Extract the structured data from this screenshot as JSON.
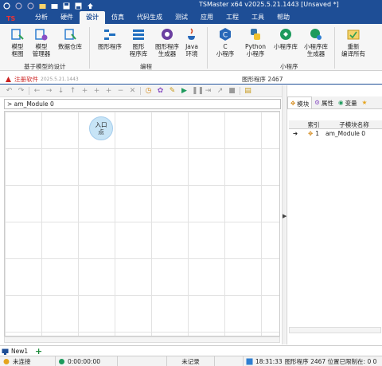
{
  "app": {
    "title": "TSMaster x64 v2025.5.21.1443 [Unsaved *]",
    "logo_text": "TS"
  },
  "quick_access": [
    "undo-icon",
    "back-icon",
    "forward-icon",
    "open-folder-icon",
    "new-folder-icon",
    "save-icon",
    "save-as-icon",
    "upload-icon"
  ],
  "menu": {
    "tabs": [
      "分析",
      "硬件",
      "设计",
      "仿真",
      "代码生成",
      "测试",
      "应用",
      "工程",
      "工具",
      "帮助"
    ],
    "active": "设计"
  },
  "ribbon": {
    "buttons": [
      {
        "label1": "模型",
        "label2": "框图",
        "icon": "model-diagram-icon",
        "color": "#2f7fd1"
      },
      {
        "label1": "模型",
        "label2": "管理器",
        "icon": "model-manager-icon",
        "color": "#2f9f54"
      },
      {
        "label1": "数据仓库",
        "label2": "",
        "icon": "data-warehouse-icon",
        "color": "#2f7fd1"
      },
      {
        "label1": "图形程序",
        "label2": "",
        "icon": "graphic-program-icon",
        "color": "#1f6fbf"
      },
      {
        "label1": "图形",
        "label2": "程序库",
        "icon": "graphic-library-icon",
        "color": "#1f6fbf"
      },
      {
        "label1": "图形程序",
        "label2": "生成器",
        "icon": "graphic-generator-icon",
        "color": "#6b3fa0"
      },
      {
        "label1": "Java",
        "label2": "环境",
        "icon": "java-icon",
        "color": "#d4471f"
      },
      {
        "label1": "C",
        "label2": "小程序",
        "icon": "c-language-icon",
        "color": "#2868b8"
      },
      {
        "label1": "Python",
        "label2": "小程序",
        "icon": "python-icon",
        "color": "#3776ab"
      },
      {
        "label1": "小程序库",
        "label2": "",
        "icon": "mini-program-library-icon",
        "color": "#1d9a5c"
      },
      {
        "label1": "小程序库",
        "label2": "生成器",
        "icon": "mini-program-generator-icon",
        "color": "#1d9a5c"
      },
      {
        "label1": "重新",
        "label2": "编译所有",
        "icon": "recompile-all-icon",
        "color": "#c79a1c"
      }
    ],
    "groups": [
      "基于模型的设计",
      "编程",
      "小程序"
    ]
  },
  "document": {
    "tab_label": "注册软件",
    "tab_version": "2025.5.21.1443",
    "title": "图形程序 2467"
  },
  "breadcrumb": "> am_Module 0",
  "canvas": {
    "entry_line1": "入口",
    "entry_line2": "点"
  },
  "side_panel": {
    "tabs": [
      {
        "label": "模块",
        "icon": "module-icon"
      },
      {
        "label": "属性",
        "icon": "properties-icon"
      },
      {
        "label": "变量",
        "icon": "variables-icon"
      },
      {
        "label": "",
        "icon": "star-icon"
      }
    ],
    "columns": [
      "索引",
      "子模块名称"
    ],
    "rows": [
      {
        "marker": "➜",
        "index": "1",
        "name": "am_Module 0"
      }
    ]
  },
  "bottom_tab": {
    "label": "New1",
    "add": "+"
  },
  "status": {
    "connection": "未连接",
    "time": "0:00:00:00",
    "record": "未记录",
    "clock": "18:31:33",
    "message": "图形程序 2467 位置已限制在: 0 0"
  },
  "colors": {
    "titlebar": "#1e4e96",
    "ribbon_bg": "#f6f6f6",
    "entry_bubble": "#c7e4f6",
    "doc_tab_text": "#cc2222"
  }
}
